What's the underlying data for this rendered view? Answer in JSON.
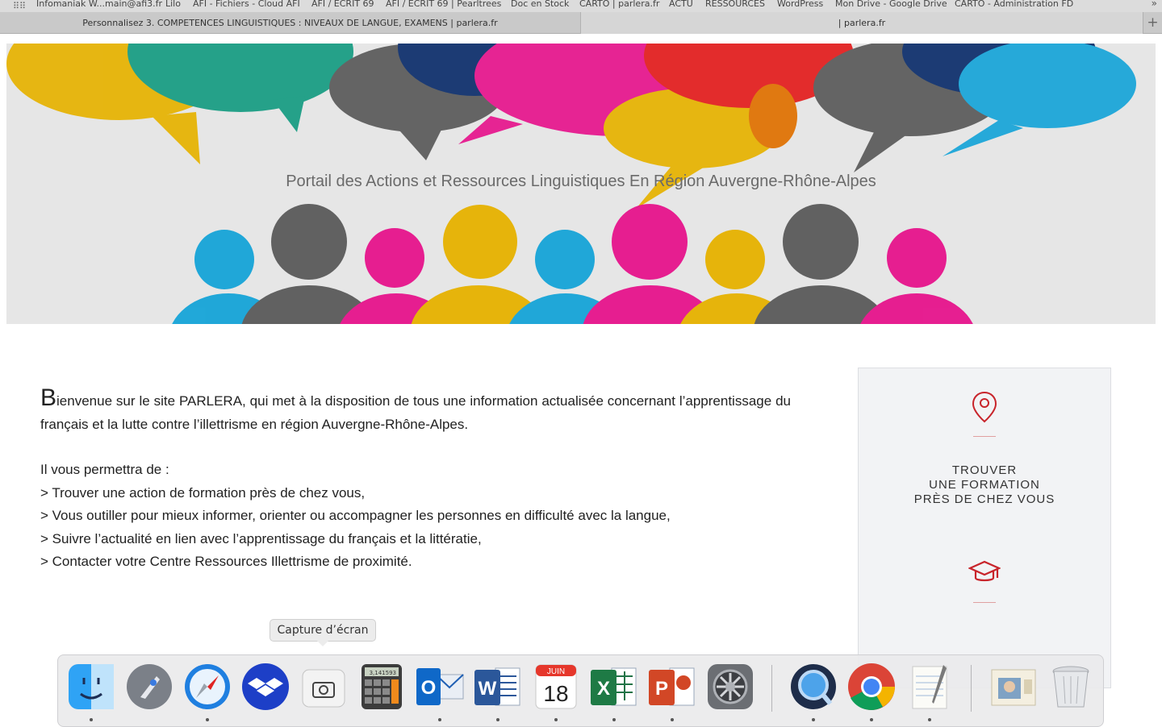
{
  "bookmarks": [
    {
      "label": "Infomaniak W...main@afi3.fr"
    },
    {
      "label": "Lilo"
    },
    {
      "label": "AFI - Fichiers - Cloud AFI"
    },
    {
      "label": "AFI / ECRIT 69"
    },
    {
      "label": "AFI / ECRIT 69 | Pearltrees"
    },
    {
      "label": "Doc en Stock"
    },
    {
      "label": "CARTO | parlera.fr"
    },
    {
      "label": "ACTU"
    },
    {
      "label": "RESSOURCES"
    },
    {
      "label": "WordPress"
    },
    {
      "label": "Mon Drive - Google Drive"
    },
    {
      "label": "CARTO - Administration FD"
    }
  ],
  "tabs": [
    {
      "label": "Personnalisez 3. COMPETENCES LINGUISTIQUES : NIVEAUX DE LANGUE, EXAMENS | parlera.fr"
    },
    {
      "label": "| parlera.fr"
    }
  ],
  "banner": {
    "tagline": "Portail des Actions et Ressources Linguistiques En Région Auvergne-Rhône-Alpes"
  },
  "welcome": {
    "dropcap": "B",
    "intro": "ienvenue sur le site PARLERA, qui met à la disposition de tous une information actualisée concernant l’apprentissage du français et la lutte contre l’illettrisme en région Auvergne-Rhône-Alpes.",
    "lead": "Il vous permettra de :",
    "items": [
      "> Trouver une action de formation près de chez vous,",
      "> Vous outiller pour mieux informer, orienter ou accompagner les personnes en difficulté avec la langue,",
      "> Suivre l’actualité en lien avec l’apprentissage du français et la littératie,",
      "> Contacter votre Centre Ressources Illettrisme de proximité."
    ]
  },
  "sidecard": {
    "line1": "TROUVER",
    "line2": "UNE FORMATION",
    "line3": "PRÈS DE CHEZ VOUS",
    "icon1": "location-pin-icon",
    "icon2": "graduation-cap-icon",
    "accent": "#c8242b"
  },
  "tooltip": {
    "label": "Capture d’écran"
  },
  "dock": {
    "calendar_month": "JUIN",
    "calendar_day": "18",
    "calc_display": "3,141593",
    "apps": [
      "finder-icon",
      "launchpad-icon",
      "safari-icon",
      "dropbox-icon",
      "screenshot-icon",
      "calculator-icon",
      "outlook-icon",
      "word-icon",
      "calendar-icon",
      "excel-icon",
      "powerpoint-icon",
      "system-preferences-icon",
      "quicktime-icon",
      "chrome-icon",
      "textedit-icon",
      "preview-icon",
      "trash-icon"
    ]
  }
}
